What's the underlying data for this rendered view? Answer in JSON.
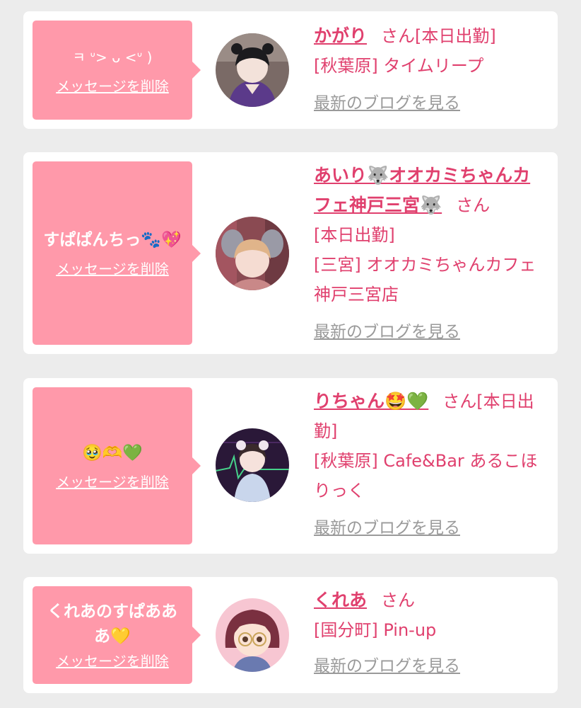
{
  "delete_label": "メッセージを削除",
  "blog_label": "最新のブログを見る",
  "honorific": "さん",
  "cards": [
    {
      "message": "ㅋ ᐡ> ᴗ <ᐡ )",
      "name": "かがり",
      "status": "[本日出勤]",
      "shop": "[秋葉原] タイムリープ"
    },
    {
      "message": "すぱぱんちっ🐾💖",
      "name": "あいり🐺オオカミちゃんカフェ神戸三宮🐺",
      "status": "[本日出勤]",
      "shop": "[三宮] オオカミちゃんカフェ神戸三宮店"
    },
    {
      "message": "🥹🫶💚",
      "name": "りちゃん🤩💚",
      "status": "[本日出勤]",
      "shop": "[秋葉原] Cafe&Bar あるこほりっく"
    },
    {
      "message": "くれあのすぱあああ💛",
      "name": "くれあ",
      "status": "",
      "shop": "[国分町] Pin-up"
    }
  ],
  "colors": {
    "background": "#ececec",
    "bubble": "#ff99aa",
    "accent": "#e0406e",
    "link_gray": "#9a9a9a"
  }
}
